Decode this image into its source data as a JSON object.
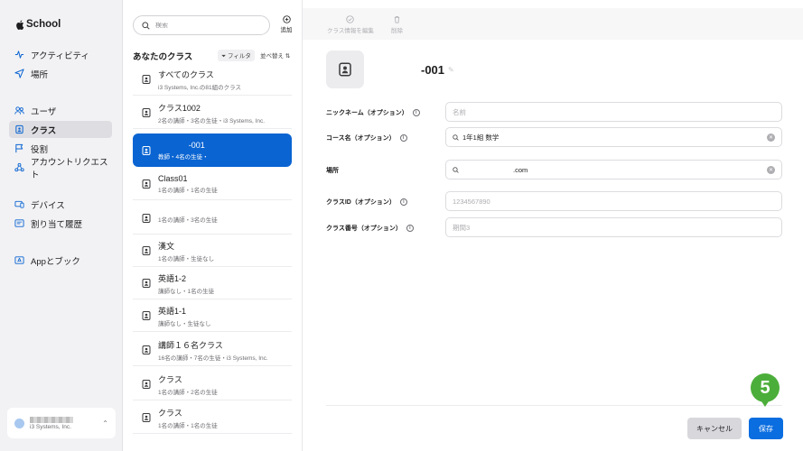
{
  "sidebar": {
    "brand": "School",
    "items": [
      {
        "label": "アクティビティ",
        "icon": "activity-icon"
      },
      {
        "label": "場所",
        "icon": "location-icon"
      },
      {
        "label": "ユーザ",
        "icon": "users-icon"
      },
      {
        "label": "クラス",
        "icon": "class-icon"
      },
      {
        "label": "役割",
        "icon": "flag-icon"
      },
      {
        "label": "アカウントリクエスト",
        "icon": "account-request-icon"
      },
      {
        "label": "デバイス",
        "icon": "devices-icon"
      },
      {
        "label": "割り当て履歴",
        "icon": "history-icon"
      },
      {
        "label": "Appとブック",
        "icon": "apps-books-icon"
      }
    ],
    "active_index": 3,
    "account": {
      "org": "i3 Systems, Inc."
    }
  },
  "list": {
    "search_placeholder": "検索",
    "add_label": "追加",
    "title": "あなたのクラス",
    "filter_label": "フィルタ",
    "sort_label": "並べ替え",
    "rows": [
      {
        "title": "すべてのクラス",
        "sub": "i3 Systems, Inc.の81組のクラス"
      },
      {
        "title": "クラス1002",
        "sub": "2名の講師・3名の生徒・i3 Systems, Inc."
      },
      {
        "title": "-001",
        "sub": "教師・4名の生徒・"
      },
      {
        "title": "Class01",
        "sub": "1名の講師・1名の生徒"
      },
      {
        "title": "",
        "sub": "1名の講師・3名の生徒"
      },
      {
        "title": "漢文",
        "sub": "1名の講師・生徒なし"
      },
      {
        "title": "英語1-2",
        "sub": "講師なし・1名の生徒"
      },
      {
        "title": "英語1-1",
        "sub": "講師なし・生徒なし"
      },
      {
        "title": "講師１６名クラス",
        "sub": "16名の講師・7名の生徒・i3 Systems, Inc."
      },
      {
        "title": "クラス",
        "sub": "1名の講師・2名の生徒"
      },
      {
        "title": "クラス",
        "sub": "1名の講師・1名の生徒"
      }
    ],
    "selected_index": 2
  },
  "detail": {
    "toolbar": {
      "edit_label": "クラス情報を編集",
      "delete_label": "削除"
    },
    "class_name": "-001",
    "fields": [
      {
        "label": "ニックネーム（オプション）",
        "value": "",
        "placeholder": "名前",
        "search": false,
        "clear": false
      },
      {
        "label": "コース名（オプション）",
        "value": "1年1組 数学",
        "placeholder": "",
        "search": true,
        "clear": true
      },
      {
        "label": "場所",
        "value": ".com",
        "placeholder": "",
        "search": true,
        "clear": true
      },
      {
        "label": "クラスID（オプション）",
        "value": "",
        "placeholder": "1234567890",
        "search": false,
        "clear": false
      },
      {
        "label": "クラス番号（オプション）",
        "value": "",
        "placeholder": "期間3",
        "search": false,
        "clear": false
      }
    ],
    "cancel_label": "キャンセル",
    "save_label": "保存",
    "step_number": "5"
  },
  "colors": {
    "accent": "#0a64d2",
    "step_badge": "#4cae3a"
  }
}
